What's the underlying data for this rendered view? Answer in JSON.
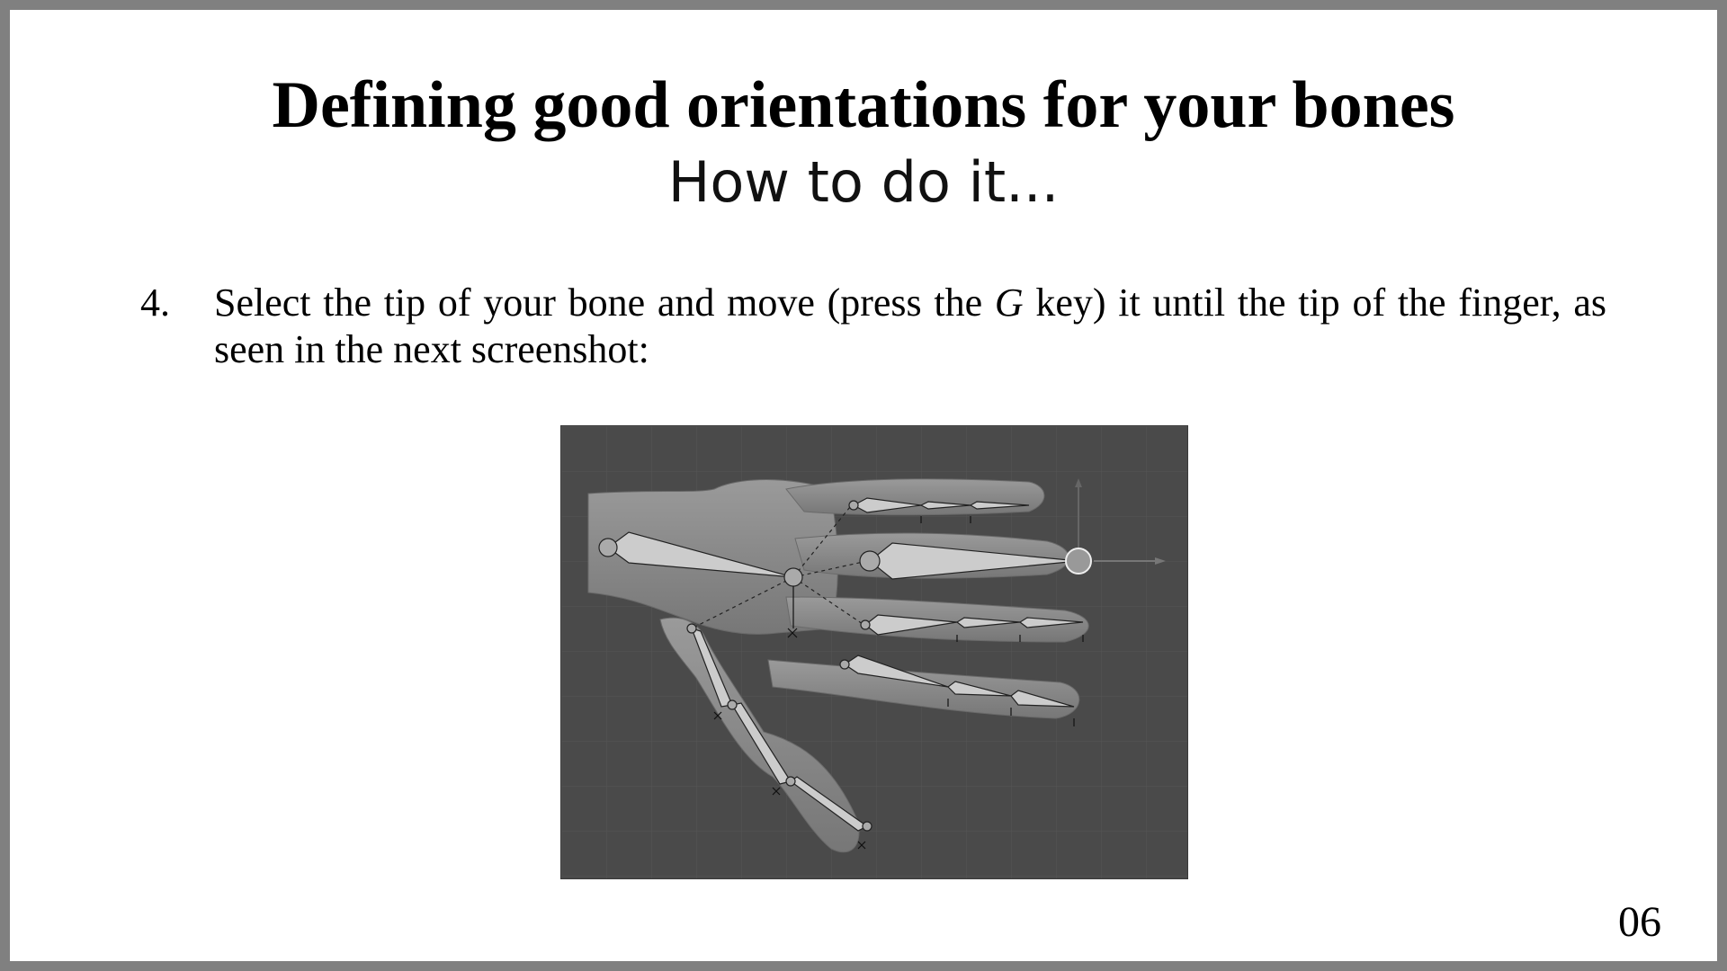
{
  "slide": {
    "title": "Defining good orientations for your bones",
    "subtitle": "How to do it...",
    "step": {
      "number": "4.",
      "text_before": "Select the tip of your bone and move (press the ",
      "key": "G",
      "text_after": " key) it until the tip of the finger, as seen in the next screenshot:"
    },
    "figure": {
      "background": "#4a4a4a",
      "hand_color": "#8c8c8c",
      "bone_color": "#c8c8c8"
    },
    "page_number": "06"
  }
}
